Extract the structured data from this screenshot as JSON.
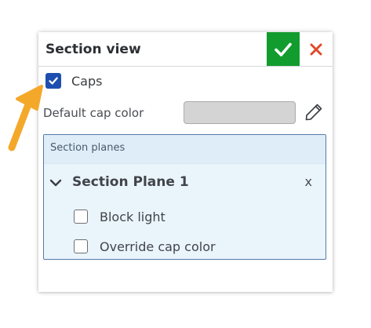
{
  "dialog": {
    "title": "Section view",
    "ok_icon": "checkmark-icon",
    "close_icon": "close-x-icon",
    "colors": {
      "ok": "#139c2e",
      "close": "#e04a2a",
      "accent": "#1e4fb0"
    }
  },
  "caps": {
    "label": "Caps",
    "checked": true
  },
  "cap_color": {
    "label": "Default cap color",
    "swatch": "#d4d4d4",
    "edit_icon": "pencil-icon"
  },
  "section_planes": {
    "title": "Section planes",
    "plane": {
      "name": "Section Plane 1",
      "remove_label": "x",
      "expanded": true,
      "options": [
        {
          "label": "Block light",
          "checked": false
        },
        {
          "label": "Override cap color",
          "checked": false
        }
      ]
    }
  },
  "annotation": {
    "arrow_icon": "pointer-arrow-icon",
    "color": "#f4a82a"
  }
}
